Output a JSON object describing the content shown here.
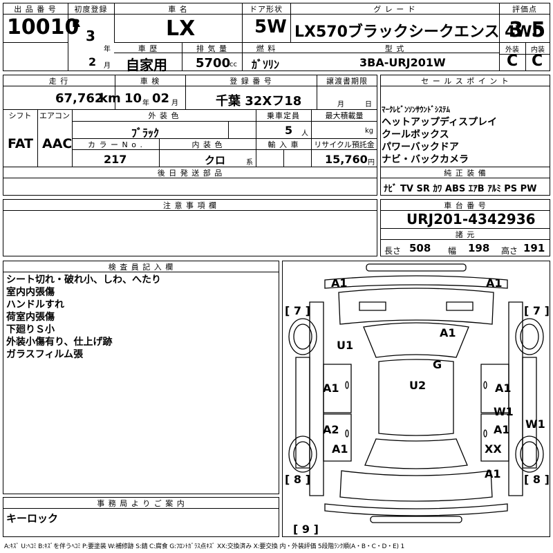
{
  "header": {
    "lot_no": {
      "label": "出 品 番 号",
      "value": "10010"
    },
    "first_reg": {
      "label": "初度登録",
      "era": "R",
      "year": "3",
      "year_unit": "年",
      "month": "2",
      "month_unit": "月"
    },
    "car_name": {
      "label": "車 名",
      "value": "LX"
    },
    "door": {
      "label": "ドア形状",
      "value": "5W"
    },
    "grade": {
      "label": "グ レ ー ド",
      "value": "LX570ブラックシークエンス 4WD"
    },
    "score": {
      "label": "評価点",
      "value": "3.5"
    },
    "history": {
      "label": "車 歴",
      "value": "自家用"
    },
    "displacement": {
      "label": "排 気 量",
      "value": "5700",
      "unit": "cc"
    },
    "fuel": {
      "label": "燃 料",
      "value": "ｶﾞｿﾘﾝ"
    },
    "model": {
      "label": "型 式",
      "value": "3BA-URJ201W"
    },
    "exterior": {
      "label": "外装",
      "value": "C"
    },
    "interior": {
      "label": "内装",
      "value": "C"
    }
  },
  "row2": {
    "mileage": {
      "label": "走 行",
      "value": "67,762",
      "unit": "km"
    },
    "inspection": {
      "label": "車 検",
      "year": "10",
      "year_unit": "年",
      "month": "02",
      "month_unit": "月"
    },
    "plate": {
      "label": "登 録 番 号",
      "value": "千葉 32Xフ18"
    },
    "transfer": {
      "label": "譲渡書期限",
      "month_unit": "月",
      "day_unit": "日"
    },
    "sales_points": {
      "label": "セ ー ル ス ポ イ ン ト",
      "items": [
        "ﾏｰｸﾚﾋﾞﾝｿﾝｻｳﾝﾄﾞｼｽﾃﾑ",
        "ヘットアップディスプレイ",
        "クールボックス",
        "パワーバックドア",
        "ナビ・バックカメラ"
      ]
    },
    "shift": {
      "label": "シフト",
      "value": "FAT"
    },
    "aircon": {
      "label": "エアコン",
      "value": "AAC"
    },
    "ext_color": {
      "label": "外 装 色",
      "value": "ﾌﾞﾗｯｸ"
    },
    "capacity": {
      "label": "乗車定員",
      "value": "5",
      "unit": "人"
    },
    "max_load": {
      "label": "最大積載量",
      "unit": "kg"
    },
    "color_no": {
      "label": "カ ラ ー N o .",
      "value": "217"
    },
    "int_color": {
      "label": "内 装 色",
      "value": "クロ",
      "unit": "系"
    },
    "import": {
      "label": "輸 入 車"
    },
    "recycle": {
      "label": "リサイクル預託金",
      "value": "15,760",
      "unit": "円"
    },
    "later_parts": {
      "label": "後 日 発 送 部 品"
    }
  },
  "equipment": {
    "label": "純 正 装 備",
    "value": "ﾅﾋﾞ TV SR ｶﾜ ABS ｴｱB ｱﾙﾐ PS PW"
  },
  "notes": {
    "label": "注 意 事 項 欄"
  },
  "chassis": {
    "label": "車 台 番 号",
    "value": "URJ201-4342936"
  },
  "dims": {
    "label": "諸 元",
    "length_label": "長さ",
    "length": "508",
    "width_label": "幅",
    "width": "198",
    "height_label": "高さ",
    "height": "191"
  },
  "inspector": {
    "label": "検 査 員 記 入 欄",
    "lines": [
      "シート切れ・破れ小、しわ、へたり",
      "室内内張傷",
      "ハンドルすれ",
      "荷室内張傷",
      "下廻りＳ小",
      "外装小傷有り、仕上げ跡",
      "ガラスフィルム張"
    ]
  },
  "diagram": {
    "marks": [
      "A1",
      "A1",
      "[ 7 ]",
      "[ 7 ]",
      "A1",
      "U1",
      "G",
      "U2",
      "A1",
      "A1",
      "W1",
      "A1",
      "W1",
      "A2",
      "A1",
      "XX",
      "A1",
      "[ 8 ]",
      "[ 8 ]",
      "[ 9 ]"
    ]
  },
  "office": {
    "label": "事 務 局 よ り ご 案 内",
    "text": "キーロック"
  },
  "legend": "A:ｷｽﾞ U:ﾍｺﾐ B:ｷｽﾞを伴うﾍｺﾐ P:要塗装 W:補修跡 S:錆 C:腐食 G:ﾌﾛﾝﾄｶﾞﾗｽ点ｷｽﾞ XX:交換済み X:要交換 内・外装評価 5段階ﾗﾝｸ順(A・B・C・D・E) 1"
}
